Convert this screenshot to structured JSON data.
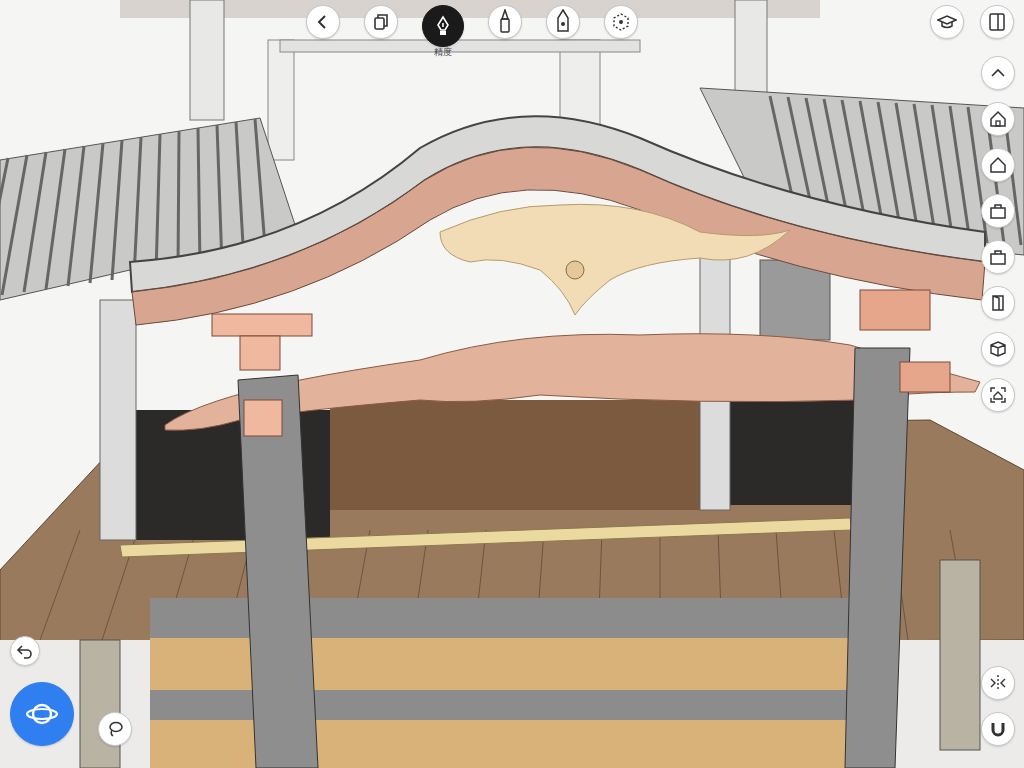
{
  "top_tools": [
    {
      "kind": "back",
      "selected": false
    },
    {
      "kind": "copy",
      "selected": false
    },
    {
      "kind": "pen",
      "selected": true,
      "label": "精度"
    },
    {
      "kind": "brush",
      "selected": false
    },
    {
      "kind": "marker",
      "selected": false
    },
    {
      "kind": "transform",
      "selected": false
    }
  ],
  "top_right": [
    {
      "kind": "cap",
      "selected": false
    },
    {
      "kind": "panel",
      "selected": false
    }
  ],
  "side_rail": [
    {
      "kind": "up",
      "selected": false
    },
    {
      "kind": "home",
      "selected": false
    },
    {
      "kind": "house",
      "selected": false
    },
    {
      "kind": "box",
      "selected": false
    },
    {
      "kind": "bag",
      "selected": false
    },
    {
      "kind": "door",
      "selected": false
    },
    {
      "kind": "cube",
      "selected": false
    },
    {
      "kind": "frame",
      "selected": false
    }
  ],
  "bottom_right": [
    {
      "kind": "split",
      "selected": false
    },
    {
      "kind": "magnet",
      "selected": false
    }
  ],
  "bottom_left": [
    {
      "kind": "undo",
      "selected": false
    },
    {
      "kind": "orbit",
      "selected": true
    },
    {
      "kind": "lasso",
      "selected": false
    }
  ]
}
